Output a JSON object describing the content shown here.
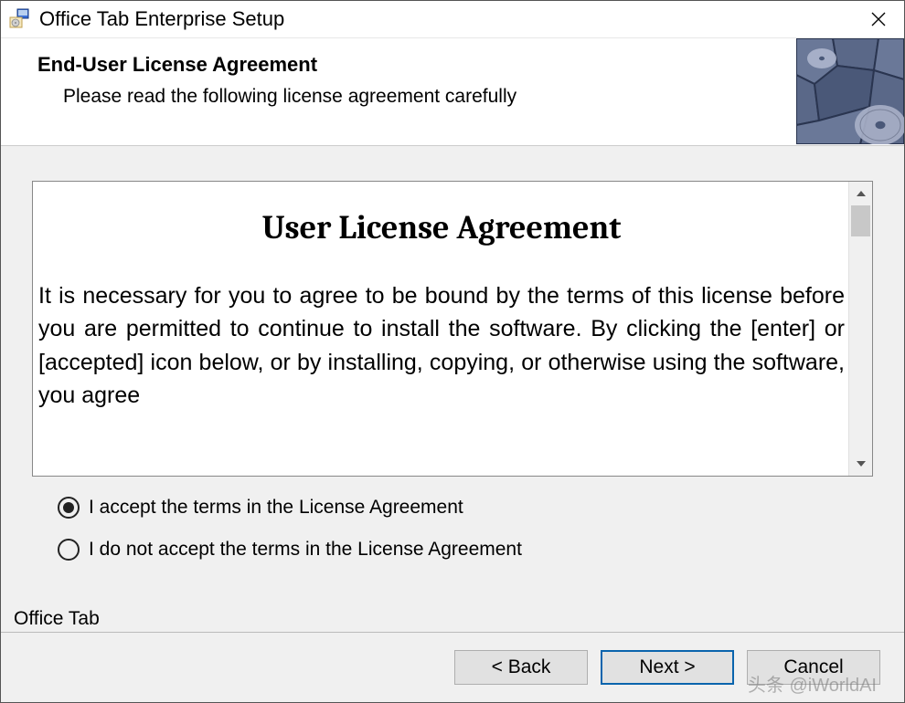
{
  "titlebar": {
    "title": "Office Tab Enterprise Setup"
  },
  "header": {
    "title": "End-User License Agreement",
    "subtitle": "Please read the following license agreement carefully"
  },
  "license": {
    "heading": "User License Agreement",
    "body": "It is necessary for you to agree to be bound by the terms of this license before you are permitted to continue to install the software. By clicking the [enter] or [accepted] icon below, or by installing, copying, or otherwise using the software, you agree"
  },
  "radios": {
    "accept": "I accept the terms in the License Agreement",
    "decline": "I do not accept the terms in the License Agreement"
  },
  "brand": "Office Tab",
  "buttons": {
    "back": "<  Back",
    "next": "Next  >",
    "cancel": "Cancel"
  },
  "watermark": "头条 @iWorldAI"
}
